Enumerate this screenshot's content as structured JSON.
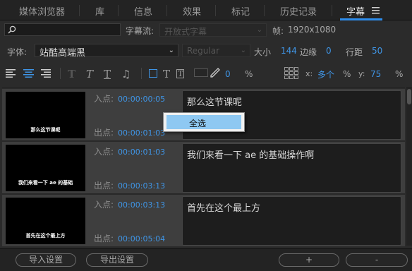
{
  "tabs": [
    {
      "label": "媒体浏览器"
    },
    {
      "label": "库"
    },
    {
      "label": "信息"
    },
    {
      "label": "效果"
    },
    {
      "label": "标记"
    },
    {
      "label": "历史记录"
    },
    {
      "label": "字幕"
    }
  ],
  "menu_icon": "hamburger-menu-icon",
  "search": {
    "placeholder": "",
    "icon": "search-icon"
  },
  "stream": {
    "label": "字幕流:",
    "value": "开放式字幕"
  },
  "frame": {
    "label": "帧:",
    "value": "1920x1080"
  },
  "font": {
    "label": "字体:",
    "family": "站酷高端黑",
    "style": "Regular",
    "size_label": "大小",
    "size": "144",
    "edge_label": "边缘",
    "edge": "0",
    "line_label": "行距",
    "line": "50"
  },
  "toolbar": {
    "opacity": "0",
    "percent": "%",
    "x_label": "x:",
    "x_value": "多个",
    "y_label": "y:",
    "y_value": "75"
  },
  "captions": [
    {
      "in_label": "入点:",
      "in": "00:00:00:05",
      "out_label": "出点:",
      "out": "00:00:01:03",
      "text": "那么这节课呢",
      "thumb_text": "那么这节课呢"
    },
    {
      "in_label": "入点:",
      "in": "00:00:01:03",
      "out_label": "出点:",
      "out": "00:00:03:13",
      "text": "我们来看一下 ae 的基础操作啊",
      "thumb_text": "我们来看一下  ae  的基础"
    },
    {
      "in_label": "入点:",
      "in": "00:00:03:13",
      "out_label": "出点:",
      "out": "00:00:05:04",
      "text": "首先在这个最上方",
      "thumb_text": "首先在这个最上方"
    }
  ],
  "context_menu": {
    "item": "全选"
  },
  "bottom": {
    "import": "导入设置",
    "export": "导出设置",
    "add": "+",
    "remove": "-"
  },
  "colors": {
    "accent": "#3f95e6",
    "menu_highlight": "#8ec8f2"
  }
}
